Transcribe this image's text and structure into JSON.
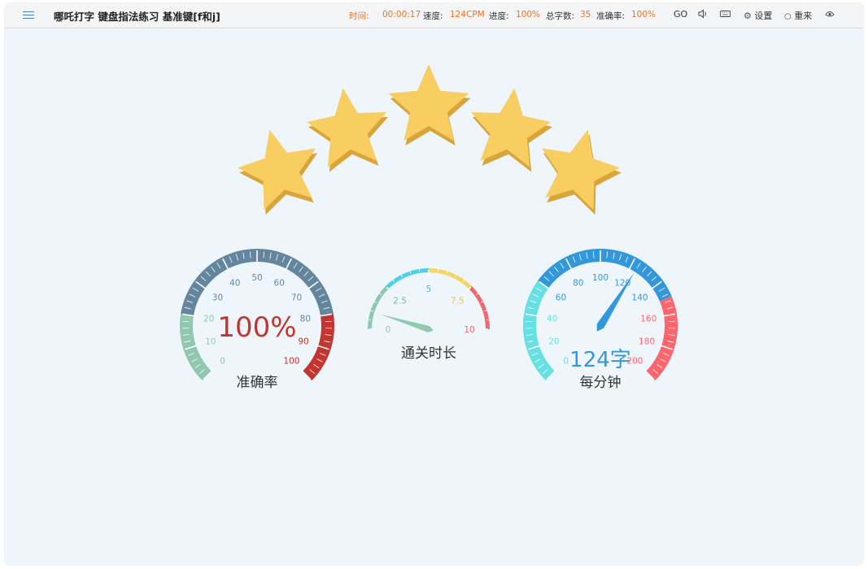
{
  "app": {
    "title": "哪吒打字 键盘指法练习 基准键[f和j]"
  },
  "stats": {
    "time_label": "时间:",
    "time_value": "00:00:17",
    "speed_label": "速度:",
    "speed_value": "124CPM",
    "progress_label": "进度:",
    "progress_value": "100%",
    "total_label": "总字数:",
    "total_value": "35",
    "accuracy_label": "准确率:",
    "accuracy_value": "100%"
  },
  "toolbar": {
    "go_label": "GO",
    "settings_label": "设置",
    "restart_label": "重来"
  },
  "rating": {
    "stars": 5
  },
  "gauges": {
    "accuracy": {
      "value": 100,
      "value_text": "100%",
      "caption": "准确率",
      "ticks": [
        "0",
        "10",
        "20",
        "30",
        "40",
        "50",
        "60",
        "70",
        "80",
        "90",
        "100"
      ],
      "max": 100
    },
    "duration": {
      "value": 0.283,
      "caption": "通关时长",
      "ticks": [
        "0",
        "2.5",
        "5",
        "7.5",
        "10"
      ],
      "max": 10
    },
    "speed": {
      "value": 124,
      "value_text": "124字",
      "caption": "每分钟",
      "ticks": [
        "0",
        "20",
        "40",
        "60",
        "80",
        "100",
        "120",
        "140",
        "160",
        "180",
        "200"
      ],
      "max": 200
    }
  },
  "colors": {
    "accent_orange": "#e8742a",
    "star": "#f8cd62",
    "accuracy_red": "#c23531",
    "accuracy_blue": "#63869e",
    "accuracy_green": "#91c7ae",
    "speed_blue": "#3398db",
    "speed_cyan": "#67e0e3",
    "speed_red": "#fd666d"
  }
}
